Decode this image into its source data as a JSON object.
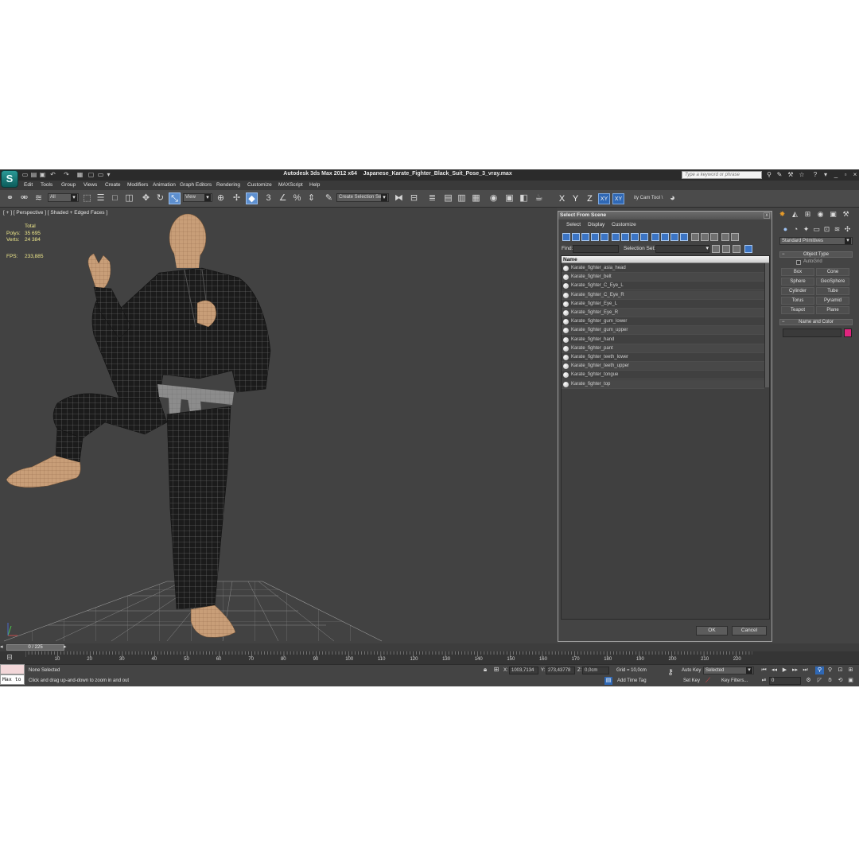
{
  "title": {
    "app": "Autodesk 3ds Max  2012 x64",
    "file": "Japanese_Karate_Fighter_Black_Suit_Pose_3_vray.max",
    "search_placeholder": "Type a keyword or phrase"
  },
  "menu": [
    "Edit",
    "Tools",
    "Group",
    "Views",
    "Create",
    "Modifiers",
    "Animation",
    "Graph Editors",
    "Rendering",
    "Customize",
    "MAXScript",
    "Help"
  ],
  "toolbar": {
    "filter": "All",
    "ref_coord": "View",
    "selection_set": "Create Selection Se",
    "axis": [
      "X",
      "Y",
      "Z",
      "XY",
      "XY"
    ],
    "cam_tool": "ity Cam Tool \\"
  },
  "viewport": {
    "label": "[ + ] [ Perspective ] [ Shaded + Edged Faces ]",
    "stats": {
      "total_label": "Total",
      "polys_label": "Polys:",
      "polys": "35 695",
      "verts_label": "Verts:",
      "verts": "24 384",
      "fps_label": "FPS:",
      "fps": "233,885"
    }
  },
  "dialog": {
    "title": "Select From Scene",
    "close": "x",
    "menu": [
      "Select",
      "Display",
      "Customize"
    ],
    "find_label": "Find:",
    "selection_set_label": "Selection Set:",
    "column_header": "Name",
    "objects": [
      "Karate_fighter_asia_head",
      "Karate_fighter_belt",
      "Karate_fighter_C_Eye_L",
      "Karate_fighter_C_Eye_R",
      "Karate_fighter_Eye_L",
      "Karate_fighter_Eye_R",
      "Karate_fighter_gum_lower",
      "Karate_fighter_gum_upper",
      "Karate_fighter_hand",
      "Karate_fighter_pant",
      "Karate_fighter_teeth_lower",
      "Karate_fighter_teeth_upper",
      "Karate_fighter_tongue",
      "Karate_fighter_top"
    ],
    "ok": "OK",
    "cancel": "Cancel"
  },
  "command_panel": {
    "category": "Standard Primitives",
    "object_type": "Object Type",
    "autogrid": "AutoGrid",
    "primitives": [
      "Box",
      "Cone",
      "Sphere",
      "GeoSphere",
      "Cylinder",
      "Tube",
      "Torus",
      "Pyramid",
      "Teapot",
      "Plane"
    ],
    "name_and_color": "Name and Color",
    "object_color": "#e0257e"
  },
  "timeline": {
    "frame_display": "0 / 225",
    "ticks": [
      "10",
      "20",
      "30",
      "40",
      "50",
      "60",
      "70",
      "80",
      "90",
      "100",
      "110",
      "120",
      "130",
      "140",
      "150",
      "160",
      "170",
      "180",
      "190",
      "200",
      "210",
      "220"
    ]
  },
  "status": {
    "maxscript_text": "Max to",
    "selection": "None Selected",
    "prompt": "Click and drag up-and-down to zoom in and out",
    "x_label": "X:",
    "x": "1003,7134",
    "y_label": "Y:",
    "y": "273,43778",
    "z_label": "Z:",
    "z": "0,0cm",
    "grid": "Grid = 10,0cm",
    "add_time_tag": "Add Time Tag",
    "auto_key": "Auto Key",
    "set_key": "Set Key",
    "key_mode": "Selected",
    "key_filters": "Key Filters...",
    "current_frame": "0"
  }
}
